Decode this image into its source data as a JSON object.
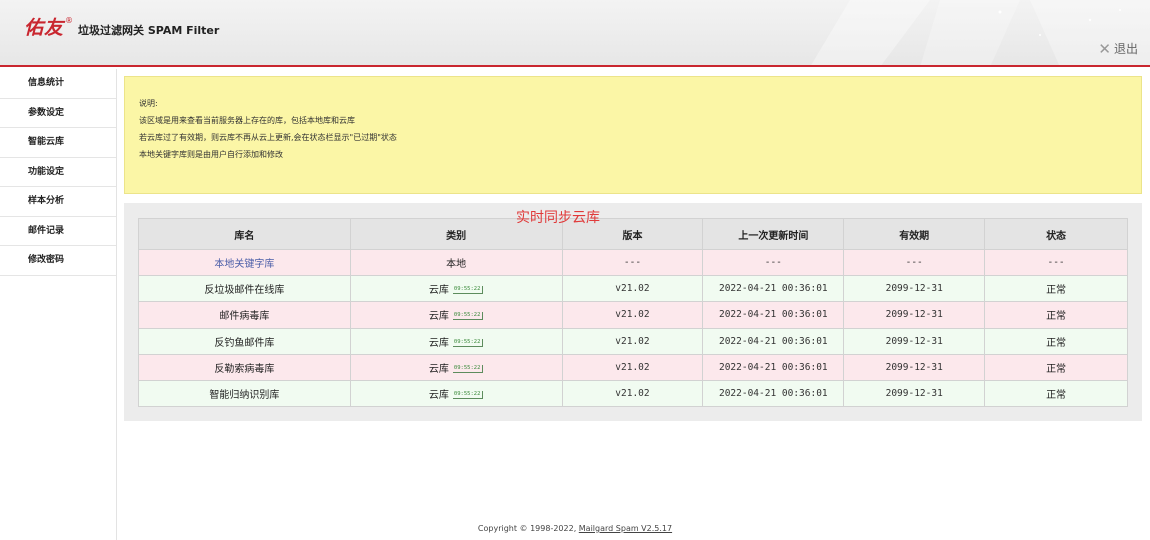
{
  "header": {
    "logo_mark": "佑友",
    "logo_reg": "®",
    "logo_text": "垃圾过滤网关 SPAM Filter",
    "logout_label": "退出"
  },
  "sidebar": {
    "items": [
      {
        "label": "信息统计"
      },
      {
        "label": "参数设定"
      },
      {
        "label": "智能云库"
      },
      {
        "label": "功能设定"
      },
      {
        "label": "样本分析"
      },
      {
        "label": "邮件记录"
      },
      {
        "label": "修改密码"
      }
    ]
  },
  "note": {
    "lines": [
      "说明:",
      "该区域是用来查看当前服务器上存在的库，包括本地库和云库",
      "若云库过了有效期，则云库不再从云上更新,会在状态栏显示\"已过期\"状态",
      "本地关键字库则是由用户自行添加和修改"
    ]
  },
  "overlay_title": "实时同步云库",
  "table": {
    "headers": [
      "库名",
      "类别",
      "版本",
      "上一次更新时间",
      "有效期",
      "状态"
    ],
    "rows": [
      {
        "name": "本地关键字库",
        "type": "本地",
        "tag": "",
        "version": "---",
        "updated": "---",
        "expires": "---",
        "status": "---",
        "link": true
      },
      {
        "name": "反垃圾邮件在线库",
        "type": "云库",
        "tag": "09:55:22",
        "version": "v21.02",
        "updated": "2022-04-21 00:36:01",
        "expires": "2099-12-31",
        "status": "正常"
      },
      {
        "name": "邮件病毒库",
        "type": "云库",
        "tag": "09:55:22",
        "version": "v21.02",
        "updated": "2022-04-21 00:36:01",
        "expires": "2099-12-31",
        "status": "正常"
      },
      {
        "name": "反钓鱼邮件库",
        "type": "云库",
        "tag": "09:55:22",
        "version": "v21.02",
        "updated": "2022-04-21 00:36:01",
        "expires": "2099-12-31",
        "status": "正常"
      },
      {
        "name": "反勒索病毒库",
        "type": "云库",
        "tag": "09:55:22",
        "version": "v21.02",
        "updated": "2022-04-21 00:36:01",
        "expires": "2099-12-31",
        "status": "正常"
      },
      {
        "name": "智能归纳识别库",
        "type": "云库",
        "tag": "09:55:22",
        "version": "v21.02",
        "updated": "2022-04-21 00:36:01",
        "expires": "2099-12-31",
        "status": "正常"
      }
    ]
  },
  "footer": {
    "copyright": "Copyright © 1998-2022, ",
    "product": "Mailgard Spam V2.5.17"
  }
}
